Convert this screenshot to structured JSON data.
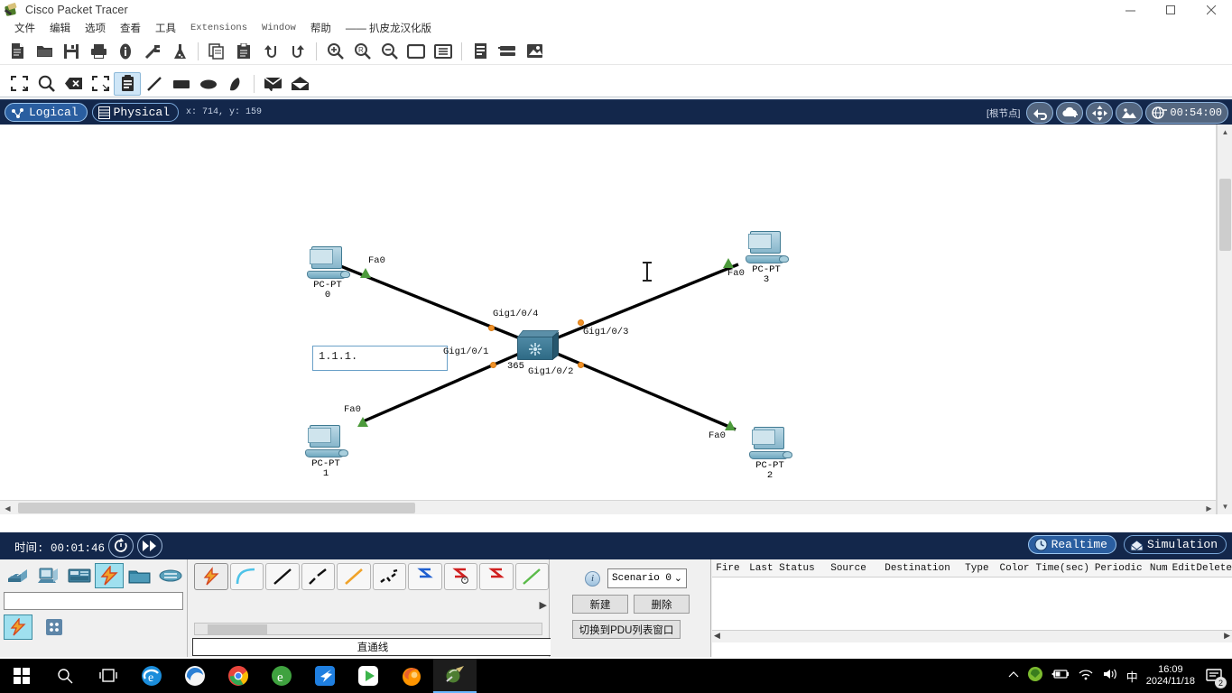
{
  "window": {
    "title": "Cisco Packet Tracer",
    "minimize": "minimize-icon",
    "maximize": "maximize-icon",
    "close": "close-icon"
  },
  "menu": {
    "items": [
      {
        "label": "文件"
      },
      {
        "label": "编辑"
      },
      {
        "label": "选项"
      },
      {
        "label": "查看"
      },
      {
        "label": "工具"
      },
      {
        "label": "Extensions"
      },
      {
        "label": "Window"
      },
      {
        "label": "帮助"
      },
      {
        "label": "—— 扒皮龙汉化版"
      }
    ]
  },
  "toolbar_main": {
    "help_label": "?",
    "buttons": [
      {
        "name": "new-file-icon"
      },
      {
        "name": "open-file-icon"
      },
      {
        "name": "save-icon"
      },
      {
        "name": "print-icon"
      },
      {
        "name": "info-icon"
      },
      {
        "name": "activity-wizard-icon"
      },
      {
        "name": "network-lab-icon"
      },
      {
        "name": "copy-icon"
      },
      {
        "name": "paste-icon"
      },
      {
        "name": "undo-icon"
      },
      {
        "name": "redo-icon"
      },
      {
        "name": "zoom-in-icon"
      },
      {
        "name": "zoom-reset-icon"
      },
      {
        "name": "zoom-out-icon"
      },
      {
        "name": "palette-window-icon"
      },
      {
        "name": "custom-devices-icon"
      },
      {
        "name": "device-list-icon"
      },
      {
        "name": "layout-icon"
      },
      {
        "name": "image-icon"
      }
    ]
  },
  "toolbar_tools": {
    "buttons": [
      {
        "name": "select-tool-icon",
        "selected": false
      },
      {
        "name": "inspect-magnifier-icon",
        "selected": false
      },
      {
        "name": "delete-tool-icon",
        "selected": false
      },
      {
        "name": "resize-shape-icon",
        "selected": false
      },
      {
        "name": "place-note-icon",
        "selected": true
      },
      {
        "name": "draw-line-icon",
        "selected": false
      },
      {
        "name": "draw-rectangle-icon",
        "selected": false
      },
      {
        "name": "draw-ellipse-icon",
        "selected": false
      },
      {
        "name": "draw-freeform-icon",
        "selected": false
      },
      {
        "name": "simple-pdu-icon",
        "selected": false
      },
      {
        "name": "complex-pdu-icon",
        "selected": false
      }
    ]
  },
  "modebar": {
    "logical_label": "Logical",
    "physical_label": "Physical",
    "coords": "x: 714, y: 159",
    "root_label": "[根节点]",
    "time": "00:54:00",
    "buttons": [
      {
        "name": "navigate-back-icon"
      },
      {
        "name": "new-cluster-icon"
      },
      {
        "name": "move-object-icon"
      },
      {
        "name": "set-tiled-background-icon"
      },
      {
        "name": "viewport-icon"
      }
    ]
  },
  "canvas": {
    "textbox": {
      "value": "1.1.1."
    },
    "devices": [
      {
        "id": "pc0",
        "type": "pc",
        "label_line1": "PC-PT",
        "label_line2": "0",
        "port": "Fa0"
      },
      {
        "id": "pc1",
        "type": "pc",
        "label_line1": "PC-PT",
        "label_line2": "1",
        "port": "Fa0"
      },
      {
        "id": "pc2",
        "type": "pc",
        "label_line1": "PC-PT",
        "label_line2": "2",
        "port": "Fa0"
      },
      {
        "id": "pc3",
        "type": "pc",
        "label_line1": "PC-PT",
        "label_line2": "3",
        "port": "Fa0"
      },
      {
        "id": "sw",
        "type": "switch",
        "label_line1": "365",
        "label_line2": ""
      }
    ],
    "switch_ports": [
      {
        "label": "Gig1/0/1"
      },
      {
        "label": "Gig1/0/2"
      },
      {
        "label": "Gig1/0/3"
      },
      {
        "label": "Gig1/0/4"
      }
    ]
  },
  "simbar": {
    "time_label": "时间: 00:01:46",
    "realtime_label": "Realtime",
    "simulation_label": "Simulation",
    "power_cycle_icon": "power-cycle-devices-icon",
    "fast_forward_icon": "fast-forward-icon"
  },
  "device_palette": {
    "categories": [
      {
        "name": "network-devices-icon",
        "selected": false
      },
      {
        "name": "end-devices-icon",
        "selected": false
      },
      {
        "name": "components-icon",
        "selected": false
      },
      {
        "name": "connections-icon",
        "selected": true
      },
      {
        "name": "miscellaneous-icon",
        "selected": false
      },
      {
        "name": "multiuser-connection-icon",
        "selected": false
      }
    ],
    "search_value": "",
    "sub_categories": [
      {
        "name": "connections-sub-icon",
        "selected": true
      },
      {
        "name": "all-devices-grid-icon",
        "selected": false
      }
    ]
  },
  "connections": {
    "caption": "直通线",
    "items": [
      {
        "name": "automatic-connection-icon",
        "selected": true
      },
      {
        "name": "console-cable-icon",
        "selected": false
      },
      {
        "name": "copper-straight-through-icon",
        "selected": false
      },
      {
        "name": "copper-crossover-icon",
        "selected": false
      },
      {
        "name": "fiber-cable-icon",
        "selected": false
      },
      {
        "name": "phone-cable-icon",
        "selected": false
      },
      {
        "name": "coaxial-cable-icon",
        "selected": false
      },
      {
        "name": "serial-dce-icon",
        "selected": false
      },
      {
        "name": "serial-dte-icon",
        "selected": false
      },
      {
        "name": "octal-cable-icon",
        "selected": false
      }
    ]
  },
  "scenario": {
    "info_icon": "info-icon",
    "selected": "Scenario 0",
    "new_label": "新建",
    "delete_label": "删除",
    "toggle_label": "切换到PDU列表窗口"
  },
  "pdu_table": {
    "columns": [
      "Fire",
      "Last Status",
      "Source",
      "Destination",
      "Type",
      "Color",
      "Time(sec)",
      "Periodic",
      "Num",
      "Edit",
      "Delete"
    ],
    "rows": []
  },
  "taskbar": {
    "items": [
      {
        "name": "start-button-icon"
      },
      {
        "name": "search-icon"
      },
      {
        "name": "task-view-icon"
      },
      {
        "name": "internet-explorer-icon"
      },
      {
        "name": "edge-legacy-icon"
      },
      {
        "name": "chrome-icon"
      },
      {
        "name": "360-browser-icon"
      },
      {
        "name": "qq-icon"
      },
      {
        "name": "media-player-icon"
      },
      {
        "name": "firefox-icon"
      },
      {
        "name": "packet-tracer-icon"
      }
    ],
    "tray": {
      "show_hidden_icon": "chevron-up-icon",
      "security_icon": "shield-icon",
      "battery_icon": "battery-icon",
      "wifi_icon": "wifi-icon",
      "volume_icon": "volume-icon",
      "ime_label": "中",
      "time": "16:09",
      "date": "2024/11/18",
      "notification_count": "2"
    }
  }
}
